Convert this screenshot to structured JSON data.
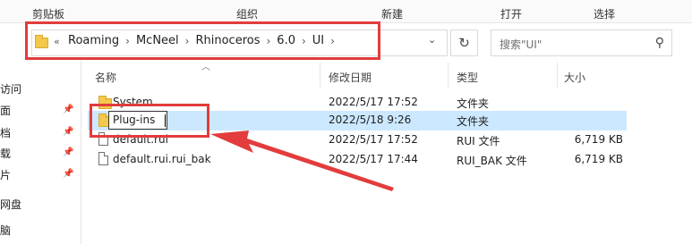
{
  "ribbon": {
    "clipboard": "剪贴板",
    "organize": "组织",
    "new": "新建",
    "open": "打开",
    "select": "选择"
  },
  "address": {
    "prefix": "«",
    "crumbs": [
      "Roaming",
      "McNeel",
      "Rhinoceros",
      "6.0",
      "UI"
    ],
    "separator": "›"
  },
  "search": {
    "placeholder": "搜索\"UI\""
  },
  "nav": {
    "items": [
      "访问",
      "面",
      "档",
      "载",
      "片",
      "网盘",
      "脑"
    ]
  },
  "columns": {
    "name": "名称",
    "modified": "修改日期",
    "type": "类型",
    "size": "大小"
  },
  "files": [
    {
      "name": "System",
      "modified": "2022/5/17 17:52",
      "type": "文件夹",
      "size": "",
      "icon": "folder-icon"
    },
    {
      "name": "Plug-ins",
      "modified": "2022/5/18 9:26",
      "type": "文件夹",
      "size": "",
      "icon": "folder-icon"
    },
    {
      "name": "default.rui",
      "modified": "2022/5/17 17:52",
      "type": "RUI 文件",
      "size": "6,719 KB",
      "icon": "file-icon"
    },
    {
      "name": "default.rui.rui_bak",
      "modified": "2022/5/17 17:44",
      "type": "RUI_BAK 文件",
      "size": "6,719 KB",
      "icon": "file-icon"
    }
  ],
  "colors": {
    "annotation": "#e23c3c",
    "selection": "#cce8ff",
    "folder": "#f4c84a"
  }
}
